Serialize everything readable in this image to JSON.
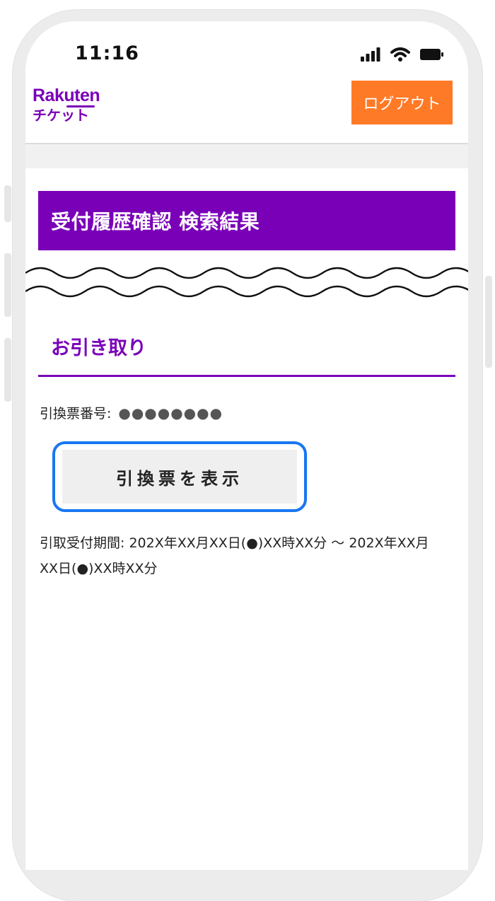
{
  "status_bar": {
    "time": "11:16",
    "icons": [
      "signal-icon",
      "wifi-icon",
      "battery-icon"
    ]
  },
  "header": {
    "logo_top": "Rakuten",
    "logo_bottom": "チケット",
    "logout_label": "ログアウト"
  },
  "page": {
    "title": "受付履歴確認 検索結果"
  },
  "pickup": {
    "section_title": "お引き取り",
    "ticket_number_label": "引換票番号:",
    "ticket_number_value": "●●●●●●●●",
    "show_ticket_button": "引換票を表示",
    "period_label": "引取受付期間:",
    "period_value": "202X年XX月XX日(●)XX時XX分 〜 202X年XX月XX日(●)XX時XX分"
  },
  "colors": {
    "brand_purple": "#7a00b8",
    "logout_orange": "#ff7a26",
    "highlight_blue": "#1877f2"
  }
}
